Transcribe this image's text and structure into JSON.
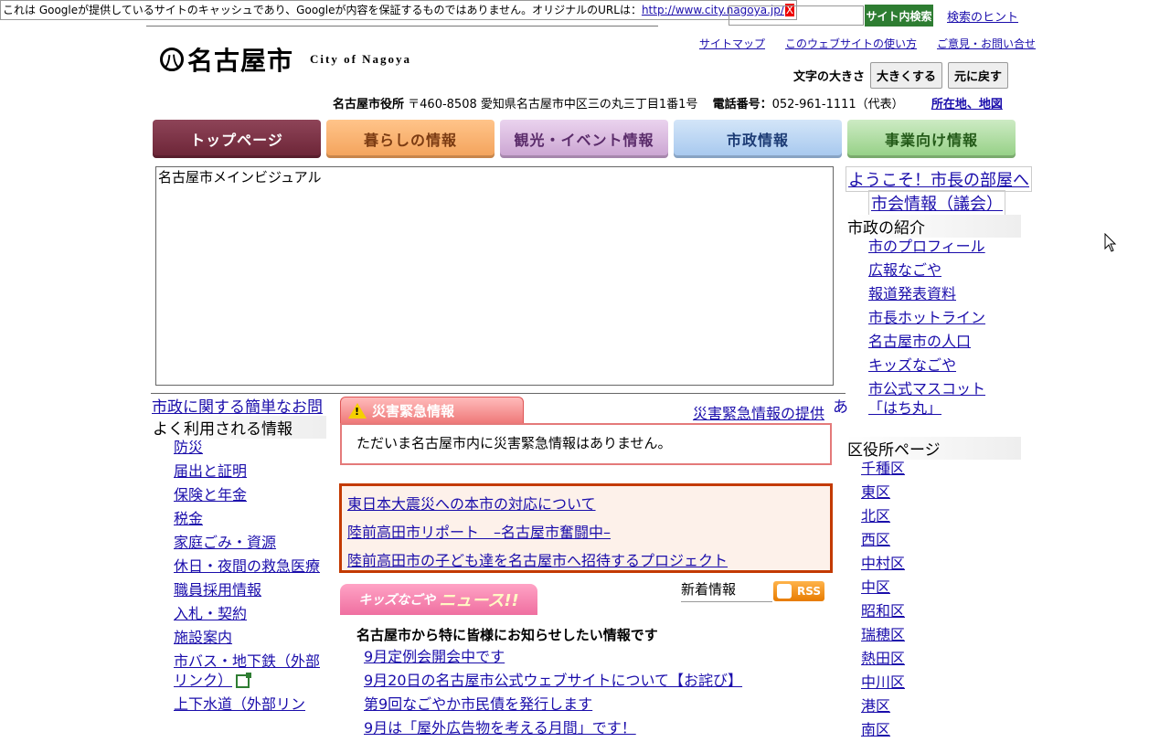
{
  "cache_banner": {
    "text": "これは Googleが提供しているサイトのキャッシュであり、Googleが内容を保証するものではありません。オリジナルのURLは：",
    "url": "http://www.city.nagoya.jp/",
    "close": "X"
  },
  "header": {
    "logo_mark": "八",
    "logo_ja": "名古屋市",
    "logo_en": "City of Nagoya",
    "search_button": "サイト内検索",
    "search_hint": "検索のヒント",
    "util_links": [
      "サイトマップ",
      "このウェブサイトの使い方",
      "ご意見・お問い合せ"
    ],
    "fontsize_label": "文字の大きさ",
    "fontsize_larger": "大きくする",
    "fontsize_reset": "元に戻す",
    "office": "名古屋市役所",
    "address": "〒460-8508 愛知県名古屋市中区三の丸三丁目1番1号",
    "phone_label": "電話番号：",
    "phone": "052-961-1111（代表）",
    "map_link": "所在地、地図"
  },
  "nav": {
    "top": "トップページ",
    "life": "暮らしの情報",
    "tour": "観光・イベント情報",
    "city": "市政情報",
    "biz": "事業向け情報"
  },
  "main_visual_alt": "名古屋市メインビジュアル",
  "simple_info": "市政に関する簡単なお問",
  "simple_info_tail": "あ",
  "left": {
    "heading": "よく利用される情報",
    "items": [
      "防災",
      "届出と証明",
      "保険と年金",
      "税金",
      "家庭ごみ・資源",
      "休日・夜間の救急医療",
      "職員採用情報",
      "入札・契約",
      "施設案内",
      "市バス・地下鉄（外部リンク）",
      "上下水道（外部リン"
    ]
  },
  "emergency": {
    "tab": "災害緊急情報",
    "provide": "災害緊急情報の提供",
    "message": "ただいま名古屋市内に災害緊急情報はありません。"
  },
  "quake_links": [
    "東日本大震災への本市の対応について",
    "陸前高田市リポート　–名古屋市奮闘中–",
    "陸前高田市の子ども達を名古屋市へ招待するプロジェクト"
  ],
  "kids": {
    "small": "キッズなごや",
    "big": "ニュース!!"
  },
  "new_label": "新着情報",
  "rss": "RSS",
  "notice": {
    "heading": "名古屋市から特に皆様にお知らせしたい情報です",
    "items": [
      "9月定例会開会中です",
      "9月20日の名古屋市公式ウェブサイトについて【お詫び】",
      "第9回なごやか市民債を発行します",
      "9月は「屋外広告物を考える月間」です！"
    ]
  },
  "right": {
    "mayor": "ようこそ！市長の部屋へ",
    "council": "市会情報（議会）",
    "heading1": "市政の紹介",
    "items1": [
      "市のプロフィール",
      "広報なごや",
      "報道発表資料",
      "市長ホットライン",
      "名古屋市の人口",
      "キッズなごや",
      "市公式マスコット「はち丸」"
    ],
    "heading2": "区役所ページ",
    "items2": [
      "千種区",
      "東区",
      "北区",
      "西区",
      "中村区",
      "中区",
      "昭和区",
      "瑞穂区",
      "熱田区",
      "中川区",
      "港区",
      "南区"
    ]
  }
}
